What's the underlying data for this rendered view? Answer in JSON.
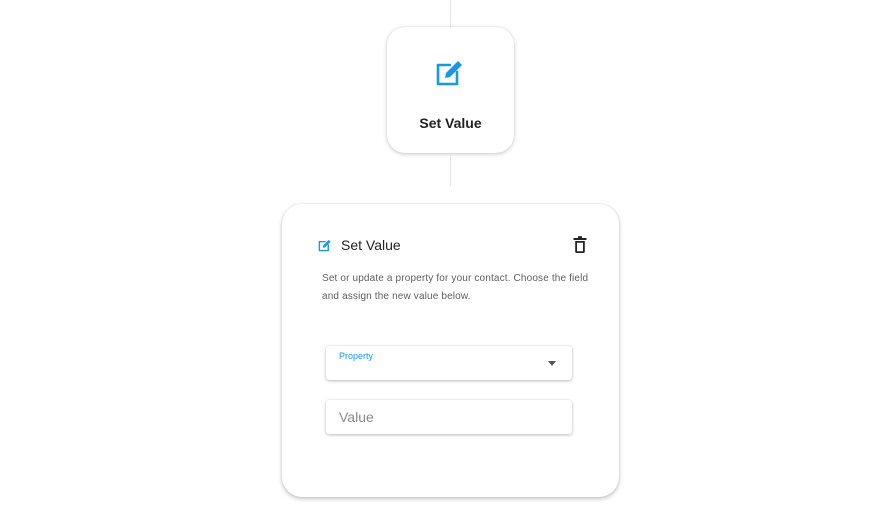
{
  "node": {
    "title": "Set Value",
    "icon": "edit-icon"
  },
  "panel": {
    "title": "Set Value",
    "icon": "edit-icon",
    "delete_icon": "trash-icon",
    "description": "Set or update a property for your contact. Choose the field and assign the new value below.",
    "property_field": {
      "label": "Property",
      "value": ""
    },
    "value_field": {
      "placeholder": "Value",
      "value": ""
    }
  },
  "colors": {
    "accent": "#1a96e8",
    "background": "#ffffff",
    "connector": "#e6e6e6"
  }
}
